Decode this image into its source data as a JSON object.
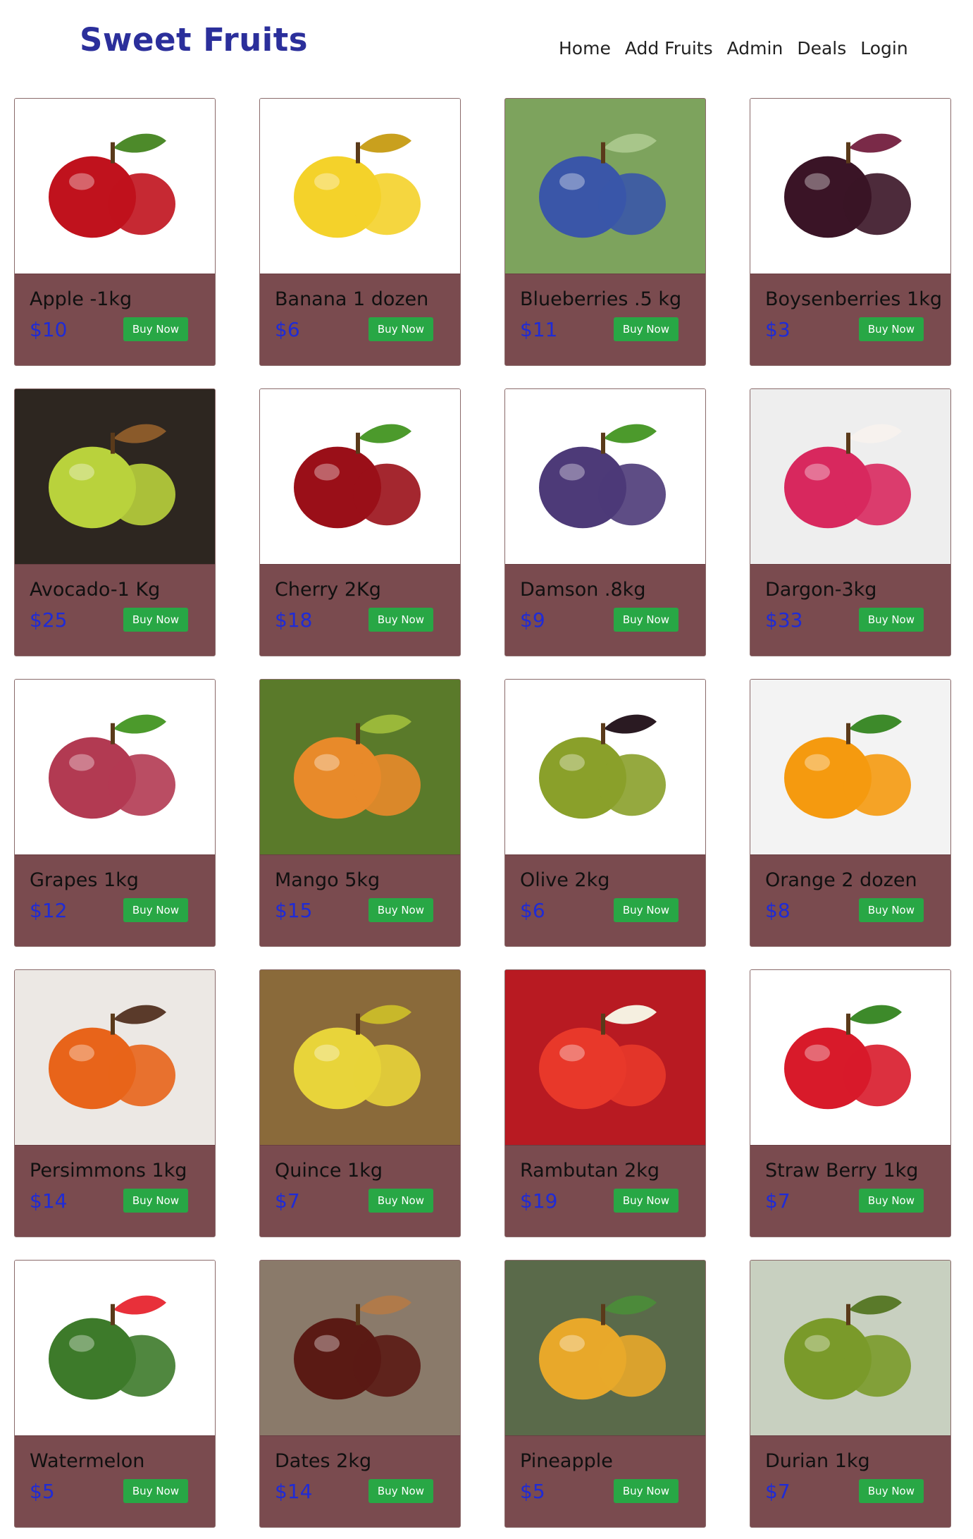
{
  "brand": "Sweet Fruits",
  "nav": [
    "Home",
    "Add Fruits",
    "Admin",
    "Deals",
    "Login"
  ],
  "products": [
    {
      "name": "Apple -1kg",
      "price": "$10",
      "button": "Buy Now",
      "icon": "apple-icon",
      "colors": [
        "#ffffff",
        "#c0121d",
        "#4d8a2a"
      ]
    },
    {
      "name": "Banana 1 dozen",
      "price": "$6",
      "button": "Buy Now",
      "icon": "banana-icon",
      "colors": [
        "#ffffff",
        "#f4d22a",
        "#c9a01e"
      ]
    },
    {
      "name": "Blueberries .5 kg",
      "price": "$11",
      "button": "Buy Now",
      "icon": "blueberries-icon",
      "colors": [
        "#7da35d",
        "#3a56a8",
        "#a8c68a"
      ]
    },
    {
      "name": "Boysenberries 1kg",
      "price": "$3",
      "button": "Buy Now",
      "icon": "boysenberries-icon",
      "colors": [
        "#ffffff",
        "#3a1426",
        "#7a2a48"
      ]
    },
    {
      "name": "Avocado-1 Kg",
      "price": "$25",
      "button": "Buy Now",
      "icon": "avocado-icon",
      "colors": [
        "#2d2620",
        "#b9d23c",
        "#8a5a2a"
      ]
    },
    {
      "name": "Cherry 2Kg",
      "price": "$18",
      "button": "Buy Now",
      "icon": "cherry-icon",
      "colors": [
        "#ffffff",
        "#9a0f18",
        "#4c9a2c"
      ]
    },
    {
      "name": "Damson .8kg",
      "price": "$9",
      "button": "Buy Now",
      "icon": "damson-icon",
      "colors": [
        "#ffffff",
        "#4d3a78",
        "#4c9a2c"
      ]
    },
    {
      "name": "Dargon-3kg",
      "price": "$33",
      "button": "Buy Now",
      "icon": "dragonfruit-icon",
      "colors": [
        "#eeeeee",
        "#d8285e",
        "#f7f2ee"
      ]
    },
    {
      "name": "Grapes 1kg",
      "price": "$12",
      "button": "Buy Now",
      "icon": "grapes-icon",
      "colors": [
        "#ffffff",
        "#b23a52",
        "#4c9a2c"
      ]
    },
    {
      "name": "Mango 5kg",
      "price": "$15",
      "button": "Buy Now",
      "icon": "mango-icon",
      "colors": [
        "#5a7a2a",
        "#e88a2a",
        "#9ab83a"
      ]
    },
    {
      "name": "Olive 2kg",
      "price": "$6",
      "button": "Buy Now",
      "icon": "olive-icon",
      "colors": [
        "#ffffff",
        "#8aa02a",
        "#2a1a22"
      ]
    },
    {
      "name": "Orange 2 dozen",
      "price": "$8",
      "button": "Buy Now",
      "icon": "orange-icon",
      "colors": [
        "#f3f3f3",
        "#f59a0f",
        "#3d8a2a"
      ]
    },
    {
      "name": "Persimmons 1kg",
      "price": "$14",
      "button": "Buy Now",
      "icon": "persimmon-icon",
      "colors": [
        "#ece8e4",
        "#e8641a",
        "#5a3a2a"
      ]
    },
    {
      "name": "Quince 1kg",
      "price": "$7",
      "button": "Buy Now",
      "icon": "quince-icon",
      "colors": [
        "#8a6a3a",
        "#e8d43a",
        "#c8b82a"
      ]
    },
    {
      "name": "Rambutan 2kg",
      "price": "$19",
      "button": "Buy Now",
      "icon": "rambutan-icon",
      "colors": [
        "#b81a22",
        "#e8382a",
        "#f5efe0"
      ]
    },
    {
      "name": "Straw Berry 1kg",
      "price": "$7",
      "button": "Buy Now",
      "icon": "strawberry-icon",
      "colors": [
        "#ffffff",
        "#d81a2a",
        "#3d8a2a"
      ]
    },
    {
      "name": "Watermelon",
      "price": "$5",
      "button": "Buy Now",
      "icon": "watermelon-icon",
      "colors": [
        "#ffffff",
        "#3d7a2a",
        "#e8303a"
      ]
    },
    {
      "name": "Dates 2kg",
      "price": "$14",
      "button": "Buy Now",
      "icon": "dates-icon",
      "colors": [
        "#8a7a6a",
        "#5a1a14",
        "#b07a4a"
      ]
    },
    {
      "name": "Pineapple",
      "price": "$5",
      "button": "Buy Now",
      "icon": "pineapple-icon",
      "colors": [
        "#5a6a4a",
        "#e8a82a",
        "#4c8a3a"
      ]
    },
    {
      "name": "Durian 1kg",
      "price": "$7",
      "button": "Buy Now",
      "icon": "durian-icon",
      "colors": [
        "#c8d0c0",
        "#7a9a2a",
        "#5a7a2a"
      ]
    }
  ]
}
